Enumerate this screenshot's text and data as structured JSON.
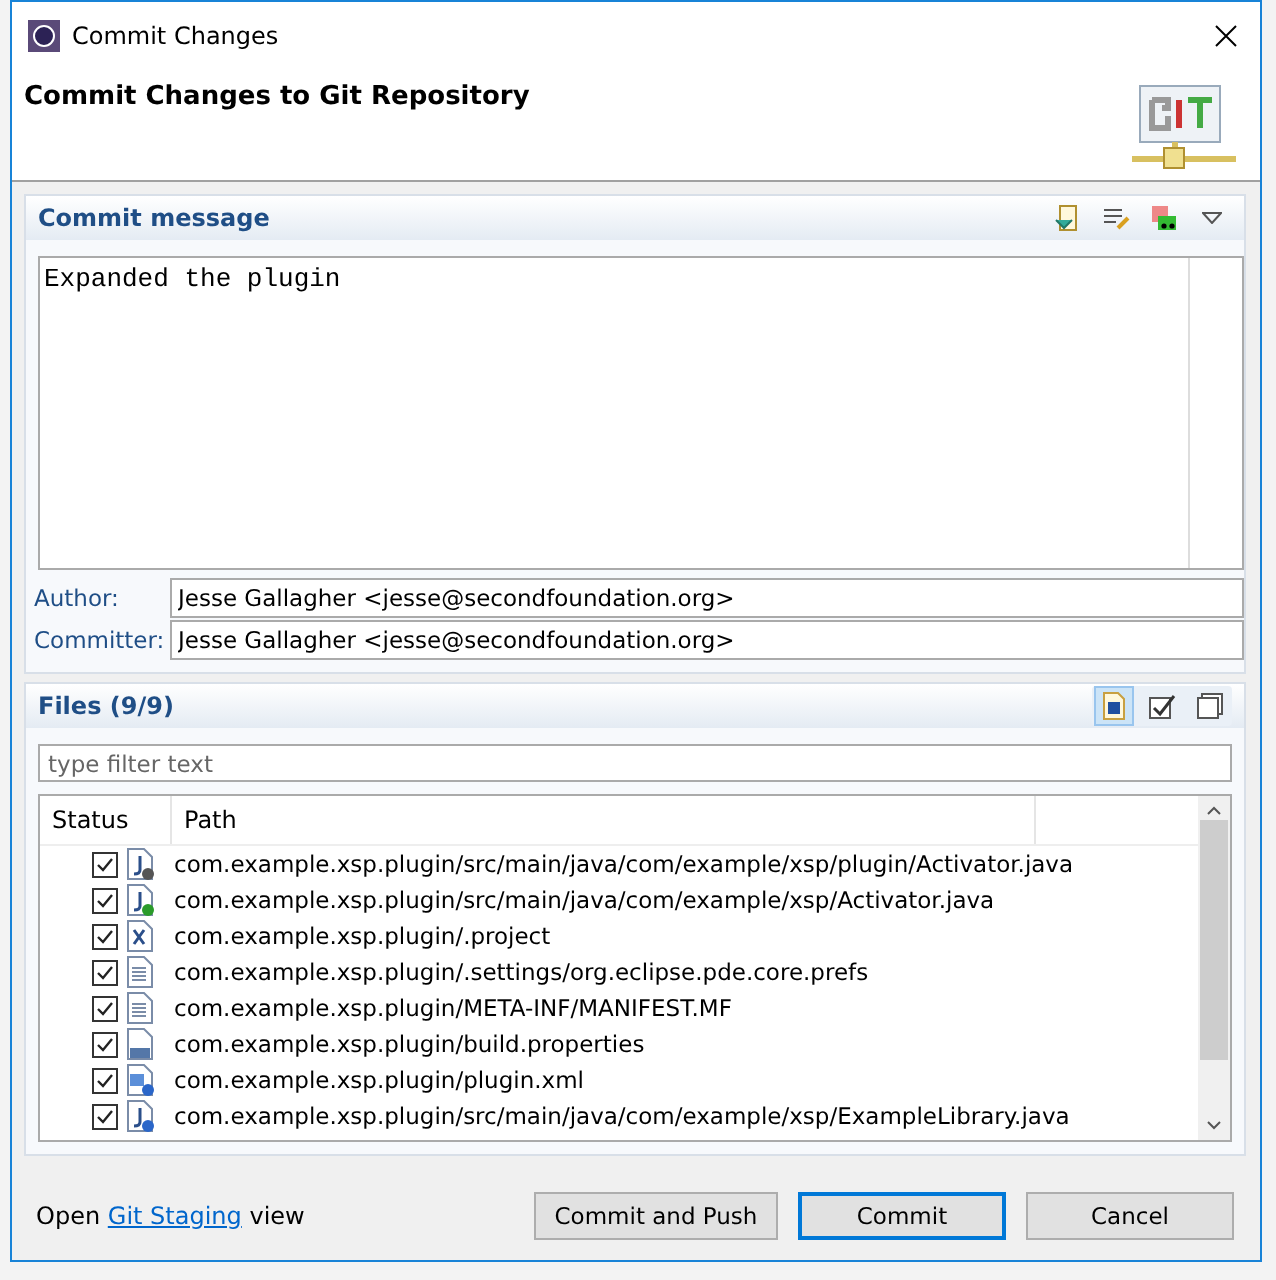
{
  "window": {
    "title": "Commit Changes"
  },
  "header": {
    "title": "Commit Changes to Git Repository"
  },
  "commit_message": {
    "title": "Commit message",
    "value": "Expanded the plugin"
  },
  "author": {
    "label": "Author:",
    "value": "Jesse Gallagher <jesse@secondfoundation.org>"
  },
  "committer": {
    "label": "Committer:",
    "value": "Jesse Gallagher <jesse@secondfoundation.org>"
  },
  "files": {
    "title": "Files (9/9)",
    "toolbar": [
      {
        "pressed": true
      },
      {
        "pressed": false
      },
      {
        "pressed": false
      }
    ],
    "filter": {
      "placeholder": "type filter text"
    },
    "columns": [
      "Status",
      "Path"
    ],
    "rows": [
      {
        "checked": true,
        "kind": "java-modified",
        "path": "com.example.xsp.plugin/src/main/java/com/example/xsp/plugin/Activator.java"
      },
      {
        "checked": true,
        "kind": "java-added",
        "path": "com.example.xsp.plugin/src/main/java/com/example/xsp/Activator.java"
      },
      {
        "checked": true,
        "kind": "xml",
        "path": "com.example.xsp.plugin/.project"
      },
      {
        "checked": true,
        "kind": "text",
        "path": "com.example.xsp.plugin/.settings/org.eclipse.pde.core.prefs"
      },
      {
        "checked": true,
        "kind": "text",
        "path": "com.example.xsp.plugin/META-INF/MANIFEST.MF"
      },
      {
        "checked": true,
        "kind": "properties",
        "path": "com.example.xsp.plugin/build.properties"
      },
      {
        "checked": true,
        "kind": "plugin-unknown",
        "path": "com.example.xsp.plugin/plugin.xml"
      },
      {
        "checked": true,
        "kind": "java-unknown",
        "path": "com.example.xsp.plugin/src/main/java/com/example/xsp/ExampleLibrary.java"
      }
    ]
  },
  "footer": {
    "before": "Open",
    "link": "Git Staging",
    "after": "view"
  },
  "buttons": [
    {
      "label": "Commit and Push",
      "default": false
    },
    {
      "label": "Commit",
      "default": true
    },
    {
      "label": "Cancel",
      "default": false
    }
  ]
}
